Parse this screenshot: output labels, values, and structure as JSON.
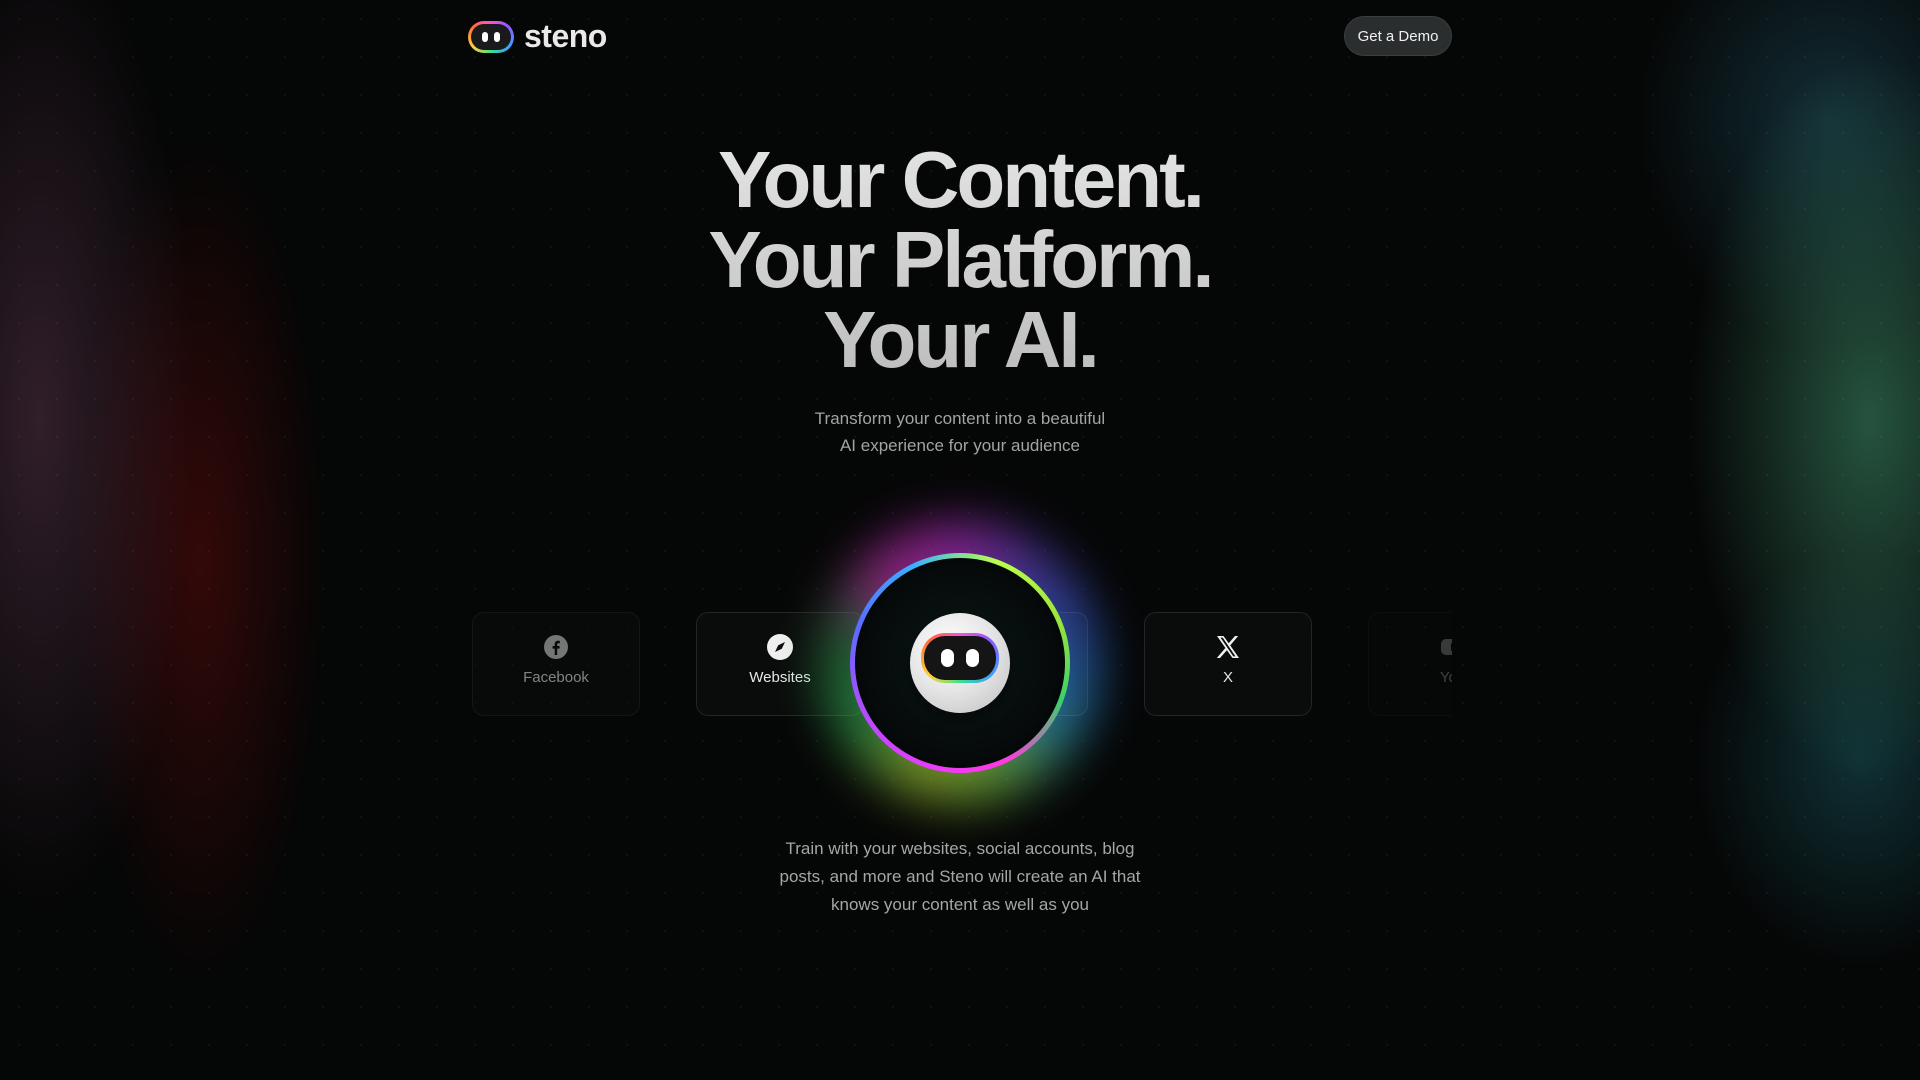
{
  "brand": {
    "name": "steno"
  },
  "nav": {
    "demo_label": "Get a Demo"
  },
  "hero": {
    "lines": [
      "Your Content.",
      "Your Platform.",
      "Your AI."
    ],
    "subtitle_lines": [
      "Transform your content into a beautiful",
      "AI experience for your audience"
    ]
  },
  "sources": [
    {
      "label": "Facebook",
      "icon": "facebook-icon"
    },
    {
      "label": "Websites",
      "icon": "compass-icon"
    },
    {
      "label": "",
      "icon": ""
    },
    {
      "label": "X",
      "icon": "x-icon"
    },
    {
      "label": "You",
      "icon": "youtube-icon"
    }
  ],
  "bottom": {
    "lines": [
      "Train with your websites, social accounts, blog",
      "posts, and more and Steno will create an AI that",
      "knows your content as well as you"
    ]
  },
  "colors": {
    "background": "#050606",
    "button_bg": "#2a2e2f",
    "muted_text": "#a3a3a3"
  }
}
